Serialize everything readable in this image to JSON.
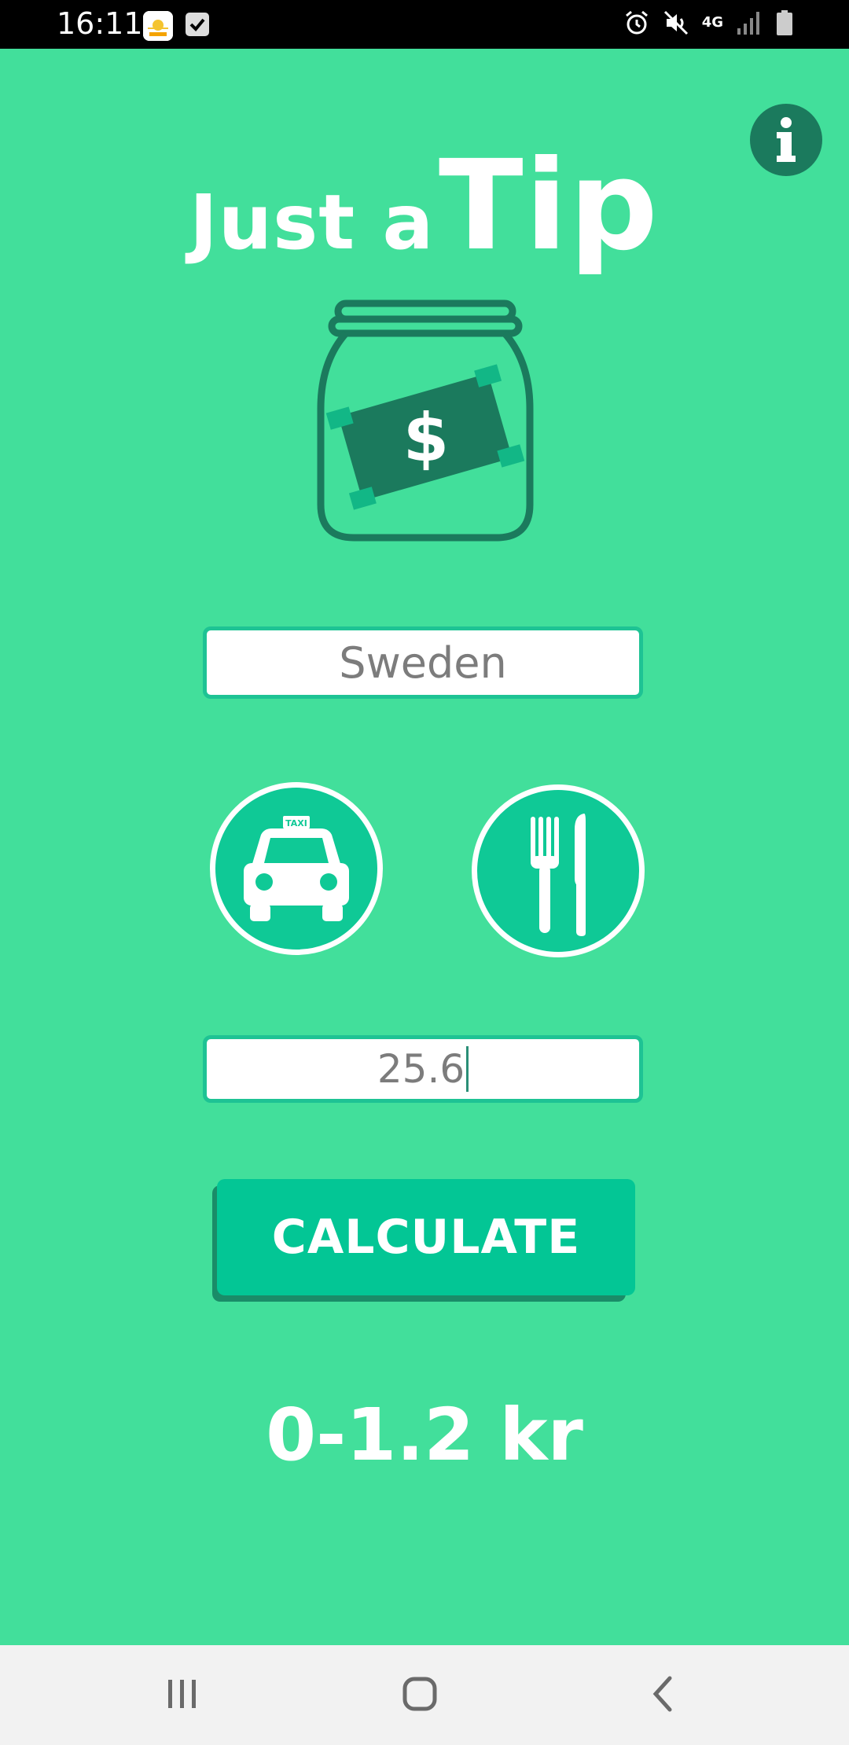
{
  "status_bar": {
    "time": "16:11",
    "network": "4G",
    "icons": [
      "app-notification-icon",
      "check-icon",
      "alarm-icon",
      "mute-icon",
      "network-4g-icon",
      "signal-icon",
      "battery-icon"
    ]
  },
  "app": {
    "title_part1": "Just a",
    "title_part2": "Tip",
    "info_label": "i",
    "jar_symbol": "$",
    "country": "Sweden",
    "amount": "25.6",
    "taxi_label": "TAXI",
    "calculate_label": "CALCULATE",
    "result": "0-1.2 kr"
  },
  "colors": {
    "background": "#42df9b",
    "accent": "#03c695",
    "dark": "#1b7a5d"
  },
  "nav_bar": {
    "icons": [
      "recent-apps-icon",
      "home-icon",
      "back-icon"
    ]
  }
}
